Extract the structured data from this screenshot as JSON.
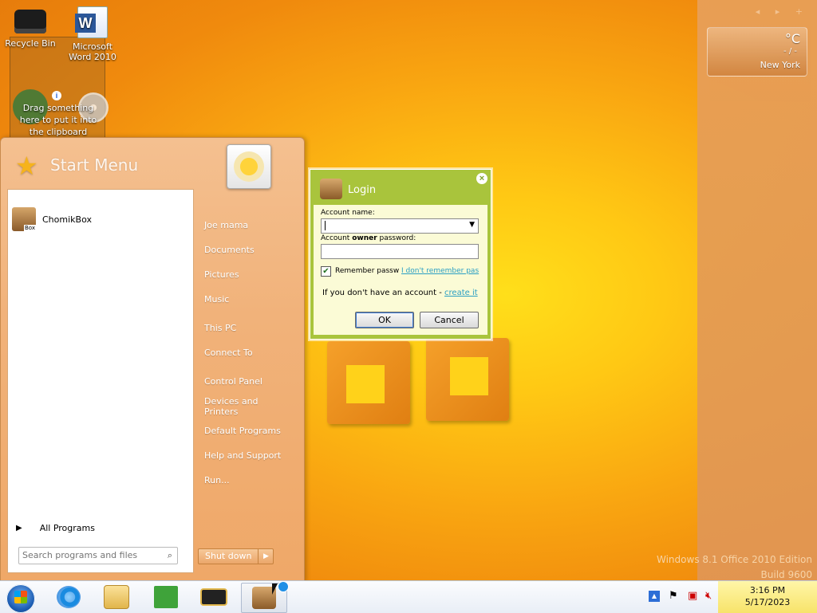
{
  "desktop": {
    "icons": [
      {
        "label": "Recycle Bin"
      },
      {
        "label": "Microsoft Word 2010"
      }
    ],
    "clipboard_hint": "Drag something here to put it into the clipboard",
    "watermark_line1": "Windows 8.1 Office 2010 Edition",
    "watermark_line2": "Build 9600"
  },
  "weather": {
    "unit": "°C",
    "temp_placeholder": "- / -",
    "city": "New York"
  },
  "start_menu": {
    "title": "Start Menu",
    "pinned": [
      {
        "label": "ChomikBox"
      }
    ],
    "all_programs": "All Programs",
    "search_placeholder": "Search programs and files",
    "right_items": [
      "Joe mama",
      "Documents",
      "Pictures",
      "Music",
      "This PC",
      "Connect To",
      "Control Panel",
      "Devices and Printers",
      "Default Programs",
      "Help and Support",
      "Run..."
    ],
    "shutdown_label": "Shut down"
  },
  "login": {
    "title": "Login",
    "account_name_label": "Account name:",
    "account_name_value": "",
    "password_label_prefix": "Account ",
    "password_label_bold": "owner",
    "password_label_suffix": " password:",
    "password_value": "",
    "remember_label": "Remember passw",
    "remember_checked": true,
    "forgot_link": "I don't remember pas",
    "no_account_text": "If you don't have an account - ",
    "create_link": "create it",
    "ok_label": "OK",
    "cancel_label": "Cancel"
  },
  "taskbar": {
    "time": "3:16 PM",
    "date": "5/17/2023"
  },
  "colors": {
    "dialog_green": "#a9c43c",
    "dialog_body": "#fbfbd6",
    "link": "#2a9fc4",
    "start_menu_orange": "#f1b27a"
  }
}
